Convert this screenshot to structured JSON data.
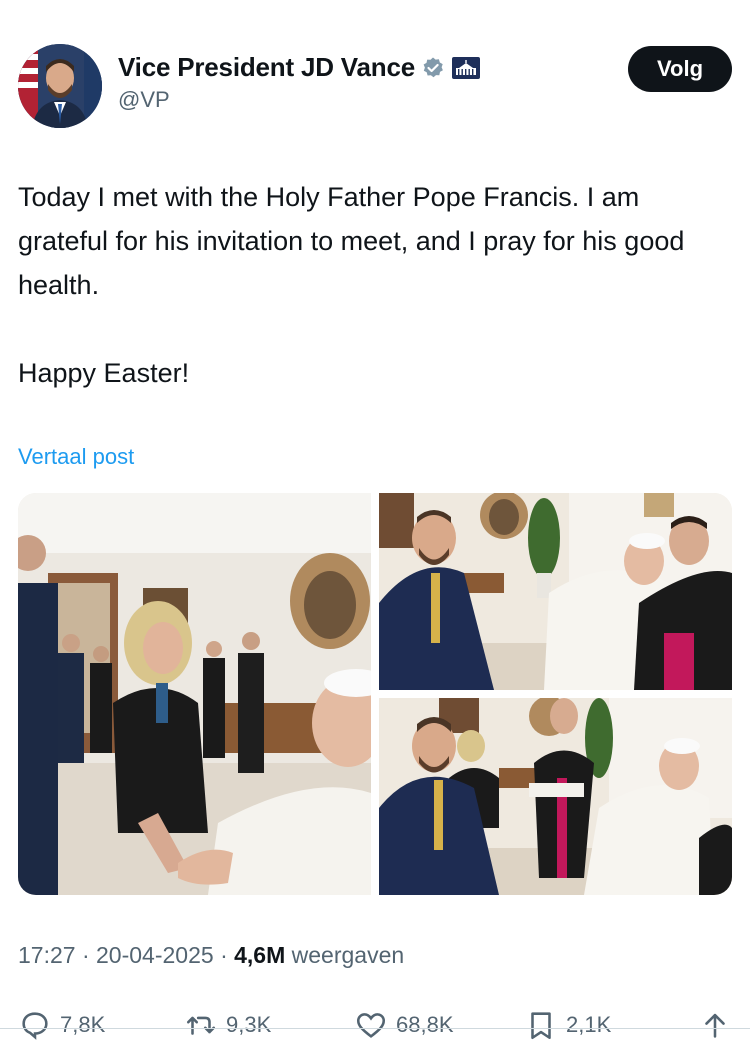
{
  "author": {
    "display_name": "Vice President JD Vance",
    "handle": "@VP",
    "verified_badge": "verified-badge-icon",
    "affiliation_badge": "white-house-icon"
  },
  "follow_button": {
    "label": "Volg"
  },
  "tweet": {
    "text": "Today I met with the Holy Father Pope Francis. I am grateful for his invitation to meet, and I pray for his good health.\n\nHappy Easter!",
    "translate_label": "Vertaal post"
  },
  "media": [
    {
      "description": "photo-1"
    },
    {
      "description": "photo-2"
    },
    {
      "description": "photo-3"
    }
  ],
  "meta": {
    "time": "17:27",
    "separator": "·",
    "date": "20-04-2025",
    "views_count": "4,6M",
    "views_label": "weergaven"
  },
  "actions": {
    "reply_count": "7,8K",
    "repost_count": "9,3K",
    "like_count": "68,8K",
    "bookmark_count": "2,1K"
  },
  "colors": {
    "text_primary": "#0f1419",
    "text_secondary": "#536471",
    "link": "#1d9bf0",
    "verified": "#829aab",
    "button_bg": "#0f1419"
  }
}
